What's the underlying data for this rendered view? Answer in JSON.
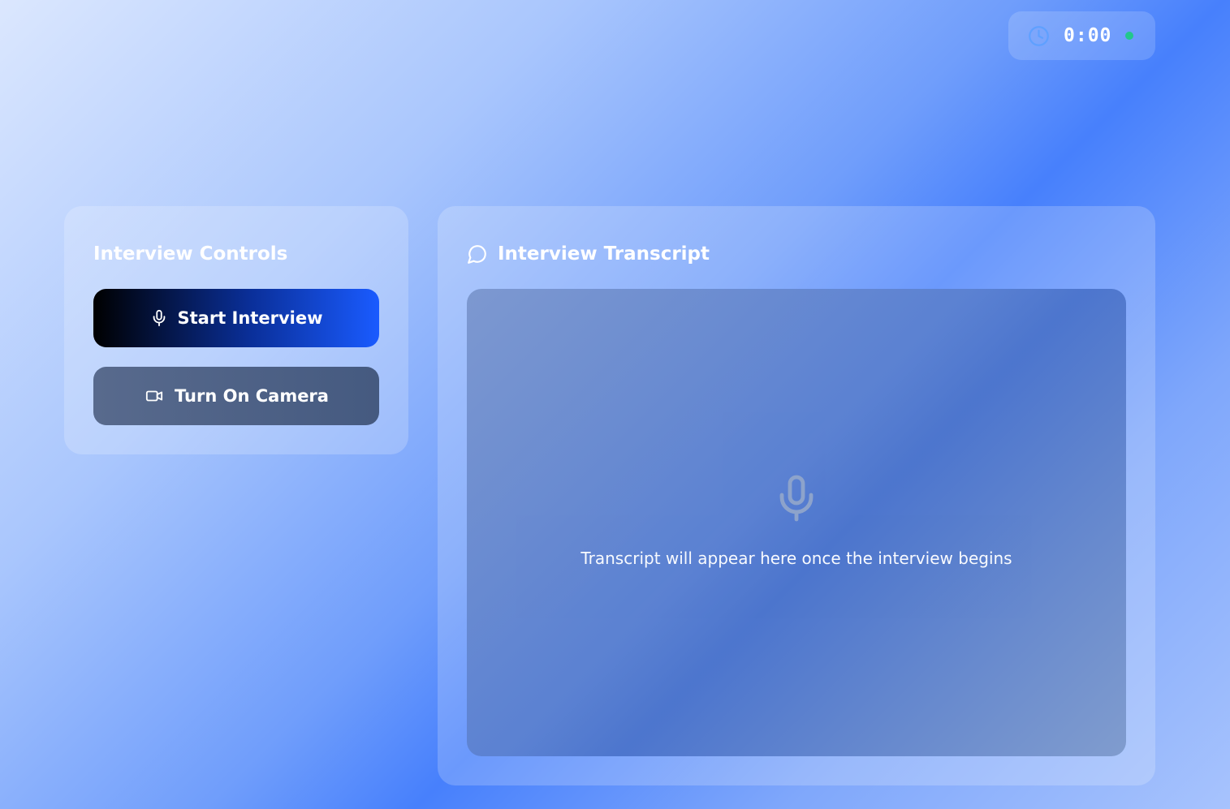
{
  "timer": {
    "icon": "clock-icon",
    "elapsed": "0:00",
    "status_color": "#22c78b"
  },
  "controls": {
    "title": "Interview Controls",
    "start_button": {
      "label": "Start Interview",
      "icon": "microphone-icon"
    },
    "camera_button": {
      "label": "Turn On Camera",
      "icon": "video-camera-icon"
    }
  },
  "transcript": {
    "title": "Interview Transcript",
    "title_icon": "chat-bubble-icon",
    "empty_icon": "microphone-icon",
    "empty_message": "Transcript will appear here once the interview begins"
  },
  "colors": {
    "accent_blue": "#1a5bff",
    "timer_icon": "#5fa0ff",
    "status_dot": "#22c78b"
  }
}
